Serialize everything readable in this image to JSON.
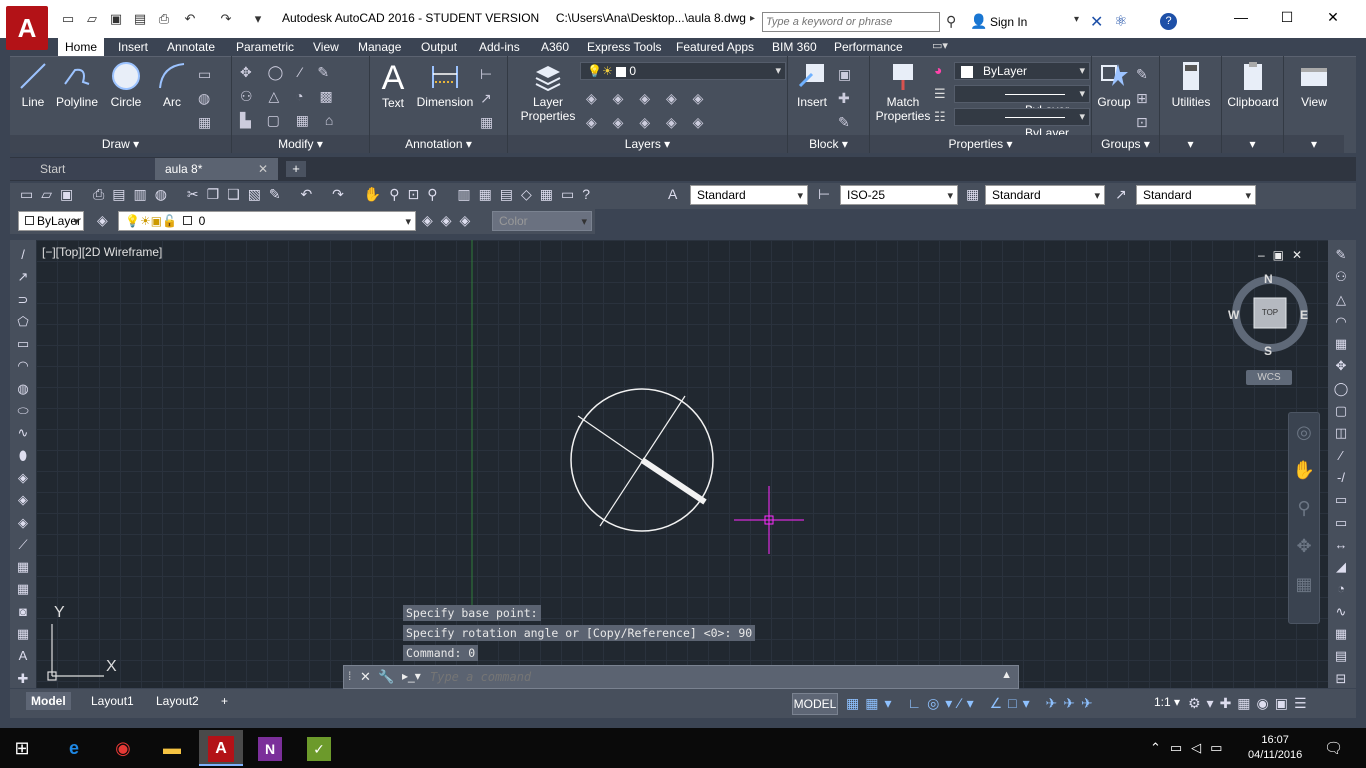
{
  "titlebar": {
    "logo": "A",
    "title": "Autodesk AutoCAD 2016 - STUDENT VERSION     C:\\Users\\Ana\\Desktop...\\aula 8.dwg",
    "search_placeholder": "Type a keyword or phrase",
    "signin": "Sign In",
    "help": "?"
  },
  "ribbon_tabs": [
    "Home",
    "Insert",
    "Annotate",
    "Parametric",
    "View",
    "Manage",
    "Output",
    "Add-ins",
    "A360",
    "Express Tools",
    "Featured Apps",
    "BIM 360",
    "Performance"
  ],
  "ribbon": {
    "draw": {
      "title": "Draw",
      "line": "Line",
      "polyline": "Polyline",
      "circle": "Circle",
      "arc": "Arc"
    },
    "modify": {
      "title": "Modify"
    },
    "annotation": {
      "title": "Annotation",
      "text": "Text",
      "text_icon": "A",
      "dimension": "Dimension"
    },
    "layers": {
      "title": "Layers",
      "layer_props_1": "Layer",
      "layer_props_2": "Properties",
      "layer_combo": "0"
    },
    "block": {
      "title": "Block",
      "insert": "Insert"
    },
    "properties": {
      "title": "Properties",
      "match_1": "Match",
      "match_2": "Properties",
      "color": "ByLayer",
      "linetype": "ByLayer",
      "lineweight": "ByLayer"
    },
    "groups": {
      "title": "Groups",
      "group": "Group"
    },
    "utilities": "Utilities",
    "clipboard": "Clipboard",
    "view": "View"
  },
  "doc_tabs": {
    "start": "Start",
    "current": "aula 8*"
  },
  "toolbar2": {
    "text_style": "Standard",
    "dim_style": "ISO-25",
    "table_style": "Standard",
    "mleader_style": "Standard"
  },
  "toolbar3": {
    "color": "ByLayer",
    "layer": "0",
    "color_placeholder": "Color"
  },
  "viewport": {
    "label": "[−][Top][2D Wireframe]"
  },
  "viewcube": {
    "n": "N",
    "s": "S",
    "e": "E",
    "w": "W",
    "top": "TOP",
    "wcs": "WCS"
  },
  "ucs": {
    "x": "X",
    "y": "Y"
  },
  "command": {
    "history": [
      "Specify base point:",
      "Specify rotation angle or [Copy/Reference] <0>: 90",
      "Command: 0"
    ],
    "placeholder": "Type a command"
  },
  "layout_tabs": [
    "Model",
    "Layout1",
    "Layout2"
  ],
  "status": {
    "model": "MODEL",
    "scale": "1:1"
  },
  "taskbar": {
    "time": "16:07",
    "date": "04/11/2016"
  }
}
